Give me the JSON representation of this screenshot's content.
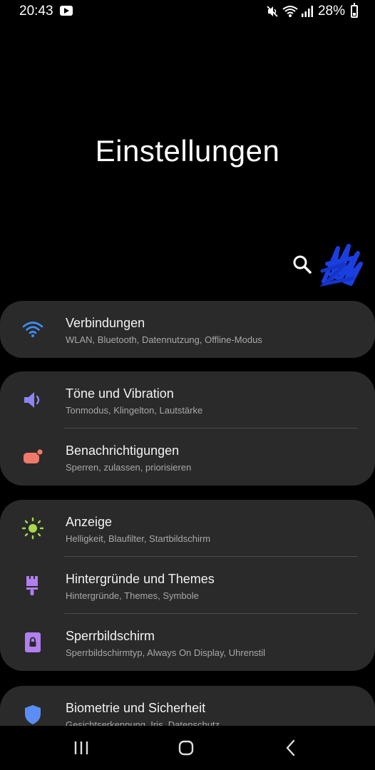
{
  "status_bar": {
    "time": "20:43",
    "battery": "28%",
    "icons": [
      "youtube-icon",
      "mute-icon",
      "wifi-icon",
      "signal-icon",
      "battery-icon"
    ]
  },
  "header": {
    "title": "Einstellungen",
    "search_icon": "search-icon",
    "avatar_icon": "account-avatar"
  },
  "groups": [
    {
      "items": [
        {
          "title": "Verbindungen",
          "subtitle": "WLAN, Bluetooth, Datennutzung, Offline-Modus",
          "icon": "wifi-icon",
          "color": "#3d8ff5"
        }
      ]
    },
    {
      "items": [
        {
          "title": "Töne und Vibration",
          "subtitle": "Tonmodus, Klingelton, Lautstärke",
          "icon": "speaker-icon",
          "color": "#8b86f2"
        },
        {
          "title": "Benachrichtigungen",
          "subtitle": "Sperren, zulassen, priorisieren",
          "icon": "notification-icon",
          "color": "#f07a6a"
        }
      ]
    },
    {
      "items": [
        {
          "title": "Anzeige",
          "subtitle": "Helligkeit, Blaufilter, Startbildschirm",
          "icon": "sun-icon",
          "color": "#a8d94a"
        },
        {
          "title": "Hintergründe und Themes",
          "subtitle": "Hintergründe, Themes, Symbole",
          "icon": "paintbrush-icon",
          "color": "#b07ff0"
        },
        {
          "title": "Sperrbildschirm",
          "subtitle": "Sperrbildschirmtyp, Always On Display, Uhrenstil",
          "icon": "lock-screen-icon",
          "color": "#b07ff0"
        }
      ]
    },
    {
      "items": [
        {
          "title": "Biometrie und Sicherheit",
          "subtitle": "Gesichtserkennung, Iris, Datenschutz",
          "icon": "shield-icon",
          "color": "#5b8ef5"
        }
      ]
    }
  ],
  "nav_bar": {
    "icons": [
      "recent-apps-icon",
      "home-icon",
      "back-icon"
    ]
  }
}
